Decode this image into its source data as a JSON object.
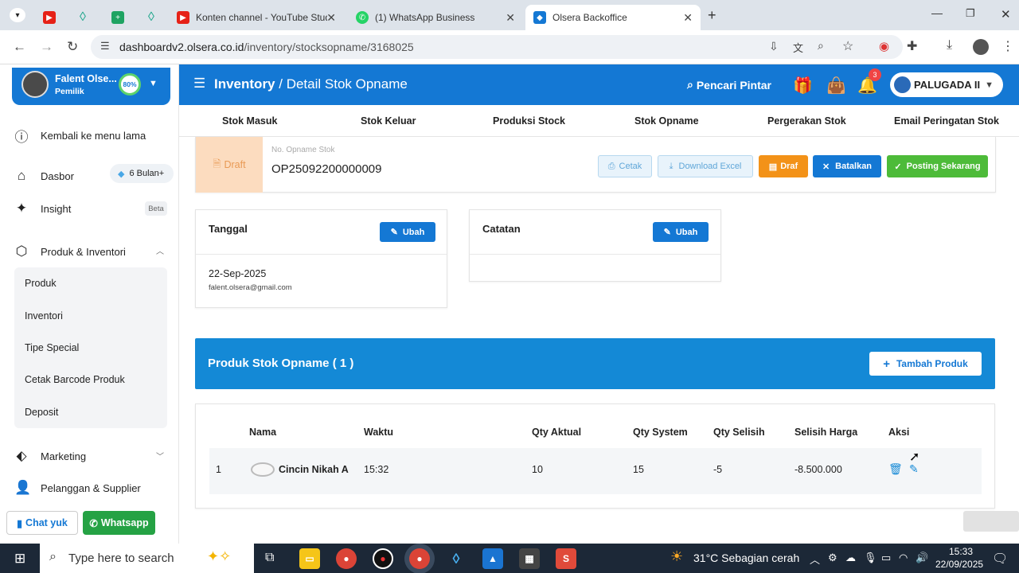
{
  "browser": {
    "tabs": [
      {
        "title": "",
        "icon": "youtube-icon"
      },
      {
        "title": "",
        "icon": "olsera-icon"
      },
      {
        "title": "",
        "icon": "sheets-icon"
      },
      {
        "title": "",
        "icon": "olsera-icon"
      },
      {
        "title": "Konten channel - YouTube Stud",
        "icon": "youtube-icon"
      },
      {
        "title": "(1) WhatsApp Business",
        "icon": "whatsapp-icon"
      },
      {
        "title": "Olsera Backoffice",
        "icon": "olsera-icon"
      }
    ],
    "url_host": "dashboardv2.olsera.co.id",
    "url_path": "/inventory/stocksopname/3168025"
  },
  "sidebar": {
    "profile_name": "Falent Olse...",
    "profile_role": "Pemilik",
    "profile_progress": "80%",
    "back_link": "Kembali ke menu lama",
    "dasbor": "Dasbor",
    "dasbor_badge": "6 Bulan+",
    "insight": "Insight",
    "insight_badge": "Beta",
    "produk_inventori": "Produk & Inventori",
    "submenu": [
      "Produk",
      "Inventori",
      "Tipe Special",
      "Cetak Barcode Produk",
      "Deposit"
    ],
    "marketing": "Marketing",
    "pelanggan": "Pelanggan & Supplier",
    "chat_yuk": "Chat yuk",
    "whatsapp": "Whatsapp"
  },
  "header": {
    "section": "Inventory",
    "page": "Detail Stok Opname",
    "smart_search": "Pencari Pintar",
    "notif_count": "3",
    "store_name": "PALUGADA II"
  },
  "subnav": [
    "Stok Masuk",
    "Stok Keluar",
    "Produksi Stock",
    "Stok Opname",
    "Pergerakan Stok",
    "Email Peringatan Stok"
  ],
  "opname": {
    "status": "Draft",
    "number_label": "No. Opname Stok",
    "number": "OP25092200000009",
    "buttons": {
      "cetak": "Cetak",
      "download": "Download Excel",
      "draf": "Draf",
      "batalkan": "Batalkan",
      "posting": "Posting Sekarang"
    }
  },
  "tanggal_panel": {
    "title": "Tanggal",
    "edit": "Ubah",
    "date": "22-Sep-2025",
    "email": "falent.olsera@gmail.com"
  },
  "catatan_panel": {
    "title": "Catatan",
    "edit": "Ubah"
  },
  "products": {
    "title": "Produk Stok Opname ( 1 )",
    "add_button": "Tambah Produk",
    "columns": [
      "Nama",
      "Waktu",
      "Qty Aktual",
      "Qty System",
      "Qty Selisih",
      "Selisih Harga",
      "Aksi"
    ],
    "rows": [
      {
        "no": "1",
        "nama": "Cincin Nikah A",
        "waktu": "15:32",
        "qty_aktual": "10",
        "qty_system": "15",
        "qty_selisih": "-5",
        "selisih_harga": "-8.500.000"
      }
    ]
  },
  "taskbar": {
    "search_placeholder": "Type here to search",
    "weather": "31°C  Sebagian cerah",
    "time": "15:33",
    "date": "22/09/2025"
  },
  "colors": {
    "primary": "#1478d4",
    "draft_bg": "#fcdcbf",
    "orange": "#f39218",
    "green": "#4dbb39",
    "whatsapp_green": "#25a244"
  }
}
